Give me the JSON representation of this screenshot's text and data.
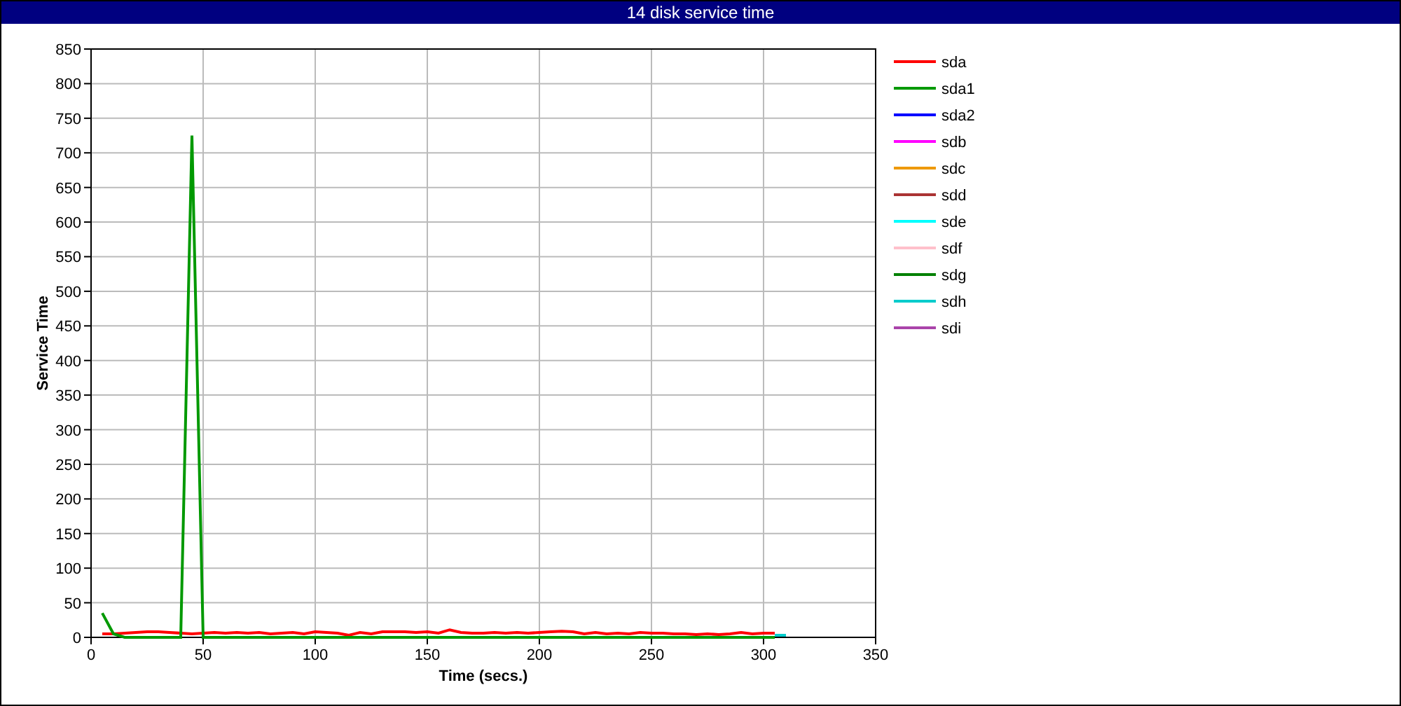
{
  "window": {
    "title": "14 disk service time"
  },
  "chart_data": {
    "type": "line",
    "xlabel": "Time (secs.)",
    "ylabel": "Service Time",
    "xlim": [
      0,
      350
    ],
    "ylim": [
      0,
      850
    ],
    "grid": true,
    "legend": true,
    "xticks": [
      0,
      50,
      100,
      150,
      200,
      250,
      300,
      350
    ],
    "yticks": [
      0,
      50,
      100,
      150,
      200,
      250,
      300,
      350,
      400,
      450,
      500,
      550,
      600,
      650,
      700,
      750,
      800,
      850
    ],
    "x": [
      5,
      10,
      15,
      20,
      25,
      30,
      35,
      40,
      45,
      50,
      55,
      60,
      65,
      70,
      75,
      80,
      85,
      90,
      95,
      100,
      105,
      110,
      115,
      120,
      125,
      130,
      135,
      140,
      145,
      150,
      155,
      160,
      165,
      170,
      175,
      180,
      185,
      190,
      195,
      200,
      205,
      210,
      215,
      220,
      225,
      230,
      235,
      240,
      245,
      250,
      255,
      260,
      265,
      270,
      275,
      280,
      285,
      290,
      295,
      300,
      305,
      310
    ],
    "series": [
      {
        "name": "sda",
        "color": "#ff0000",
        "values": [
          5,
          5,
          6,
          7,
          8,
          8,
          7,
          6,
          5,
          6,
          7,
          6,
          7,
          6,
          7,
          5,
          6,
          7,
          5,
          8,
          7,
          6,
          3,
          7,
          5,
          8,
          8,
          8,
          7,
          8,
          6,
          11,
          7,
          6,
          6,
          7,
          6,
          7,
          6,
          7,
          8,
          9,
          8,
          5,
          7,
          5,
          6,
          5,
          7,
          6,
          6,
          5,
          5,
          4,
          5,
          4,
          5,
          7,
          5,
          6,
          6,
          null
        ]
      },
      {
        "name": "sda1",
        "color": "#009900",
        "values": [
          35,
          5,
          0,
          0,
          0,
          0,
          0,
          0,
          725,
          0,
          0,
          0,
          0,
          0,
          0,
          0,
          0,
          0,
          0,
          0,
          0,
          0,
          0,
          0,
          0,
          0,
          0,
          0,
          0,
          0,
          0,
          0,
          0,
          0,
          0,
          0,
          0,
          0,
          0,
          0,
          0,
          0,
          0,
          0,
          0,
          0,
          0,
          0,
          0,
          0,
          0,
          0,
          0,
          0,
          0,
          0,
          0,
          0,
          0,
          0,
          0,
          null
        ]
      },
      {
        "name": "sda2",
        "color": "#0000ff",
        "values": [
          null,
          null,
          null,
          null,
          null,
          null,
          null,
          null,
          null,
          null,
          null,
          null,
          null,
          null,
          null,
          null,
          null,
          null,
          null,
          null,
          null,
          null,
          null,
          null,
          null,
          null,
          null,
          null,
          null,
          null,
          null,
          null,
          null,
          null,
          null,
          null,
          null,
          null,
          null,
          null,
          null,
          null,
          null,
          null,
          null,
          null,
          null,
          null,
          null,
          null,
          null,
          null,
          null,
          null,
          null,
          null,
          null,
          null,
          null,
          null,
          null,
          null
        ]
      },
      {
        "name": "sdb",
        "color": "#ff00ff",
        "values": [
          null,
          null,
          null,
          null,
          null,
          null,
          null,
          null,
          null,
          null,
          null,
          null,
          null,
          null,
          null,
          null,
          null,
          null,
          null,
          null,
          null,
          null,
          null,
          null,
          null,
          null,
          null,
          null,
          null,
          null,
          null,
          null,
          null,
          null,
          null,
          null,
          null,
          null,
          null,
          null,
          null,
          null,
          null,
          null,
          null,
          null,
          null,
          null,
          null,
          null,
          null,
          null,
          null,
          null,
          null,
          null,
          null,
          null,
          null,
          null,
          null,
          null
        ]
      },
      {
        "name": "sdc",
        "color": "#ee9900",
        "values": [
          null,
          null,
          null,
          null,
          null,
          null,
          null,
          null,
          null,
          null,
          null,
          null,
          null,
          null,
          null,
          null,
          null,
          null,
          null,
          null,
          null,
          null,
          null,
          null,
          null,
          null,
          null,
          null,
          null,
          null,
          null,
          null,
          null,
          null,
          null,
          null,
          null,
          null,
          null,
          null,
          null,
          null,
          null,
          null,
          null,
          null,
          null,
          null,
          null,
          null,
          null,
          null,
          null,
          null,
          null,
          null,
          null,
          null,
          null,
          null,
          null,
          null
        ]
      },
      {
        "name": "sdd",
        "color": "#aa3333",
        "values": [
          null,
          null,
          null,
          null,
          null,
          null,
          null,
          null,
          null,
          null,
          null,
          null,
          null,
          null,
          null,
          null,
          null,
          null,
          null,
          null,
          null,
          null,
          null,
          null,
          null,
          null,
          null,
          null,
          null,
          null,
          null,
          null,
          null,
          null,
          null,
          null,
          null,
          null,
          null,
          null,
          null,
          null,
          null,
          null,
          null,
          null,
          null,
          null,
          null,
          null,
          null,
          null,
          null,
          null,
          null,
          null,
          null,
          null,
          null,
          null,
          null,
          null
        ]
      },
      {
        "name": "sde",
        "color": "#00ffff",
        "values": [
          null,
          null,
          null,
          null,
          null,
          null,
          null,
          null,
          null,
          null,
          null,
          null,
          null,
          null,
          null,
          null,
          null,
          null,
          null,
          null,
          null,
          null,
          null,
          null,
          null,
          null,
          null,
          null,
          null,
          null,
          null,
          null,
          null,
          null,
          null,
          null,
          null,
          null,
          null,
          null,
          null,
          null,
          null,
          null,
          null,
          null,
          null,
          null,
          null,
          null,
          null,
          null,
          null,
          null,
          null,
          null,
          null,
          null,
          null,
          null,
          null,
          null
        ]
      },
      {
        "name": "sdf",
        "color": "#ffc0cb",
        "values": [
          null,
          null,
          null,
          null,
          null,
          null,
          null,
          null,
          null,
          null,
          null,
          null,
          null,
          null,
          null,
          null,
          null,
          null,
          null,
          null,
          null,
          null,
          null,
          null,
          null,
          null,
          null,
          null,
          null,
          null,
          null,
          null,
          null,
          null,
          null,
          null,
          null,
          null,
          null,
          null,
          null,
          null,
          null,
          null,
          null,
          null,
          null,
          null,
          null,
          null,
          null,
          null,
          null,
          null,
          null,
          null,
          null,
          null,
          null,
          null,
          null,
          null
        ]
      },
      {
        "name": "sdg",
        "color": "#008000",
        "values": [
          null,
          null,
          null,
          null,
          null,
          null,
          null,
          null,
          null,
          null,
          null,
          null,
          null,
          null,
          null,
          null,
          null,
          null,
          null,
          null,
          null,
          null,
          null,
          null,
          null,
          null,
          null,
          null,
          null,
          null,
          null,
          null,
          null,
          null,
          null,
          null,
          null,
          null,
          null,
          null,
          null,
          null,
          null,
          null,
          null,
          null,
          null,
          null,
          null,
          null,
          null,
          null,
          null,
          null,
          null,
          null,
          null,
          null,
          null,
          null,
          null,
          null
        ]
      },
      {
        "name": "sdh",
        "color": "#00cccc",
        "values": [
          null,
          null,
          null,
          null,
          null,
          null,
          null,
          null,
          null,
          null,
          null,
          null,
          null,
          null,
          null,
          null,
          null,
          null,
          null,
          null,
          null,
          null,
          null,
          null,
          null,
          null,
          null,
          null,
          null,
          null,
          null,
          null,
          null,
          null,
          null,
          null,
          null,
          null,
          null,
          null,
          null,
          null,
          null,
          null,
          null,
          null,
          null,
          null,
          null,
          null,
          null,
          null,
          null,
          null,
          null,
          null,
          null,
          null,
          null,
          null,
          3,
          3
        ]
      },
      {
        "name": "sdi",
        "color": "#aa44aa",
        "values": [
          null,
          null,
          null,
          null,
          null,
          null,
          null,
          null,
          null,
          null,
          null,
          null,
          null,
          null,
          null,
          null,
          null,
          null,
          null,
          null,
          null,
          null,
          null,
          null,
          null,
          null,
          null,
          null,
          null,
          null,
          null,
          null,
          null,
          null,
          null,
          null,
          null,
          null,
          null,
          null,
          null,
          null,
          null,
          null,
          null,
          null,
          null,
          null,
          null,
          null,
          null,
          null,
          null,
          null,
          null,
          null,
          null,
          null,
          null,
          null,
          null,
          null
        ]
      }
    ]
  }
}
